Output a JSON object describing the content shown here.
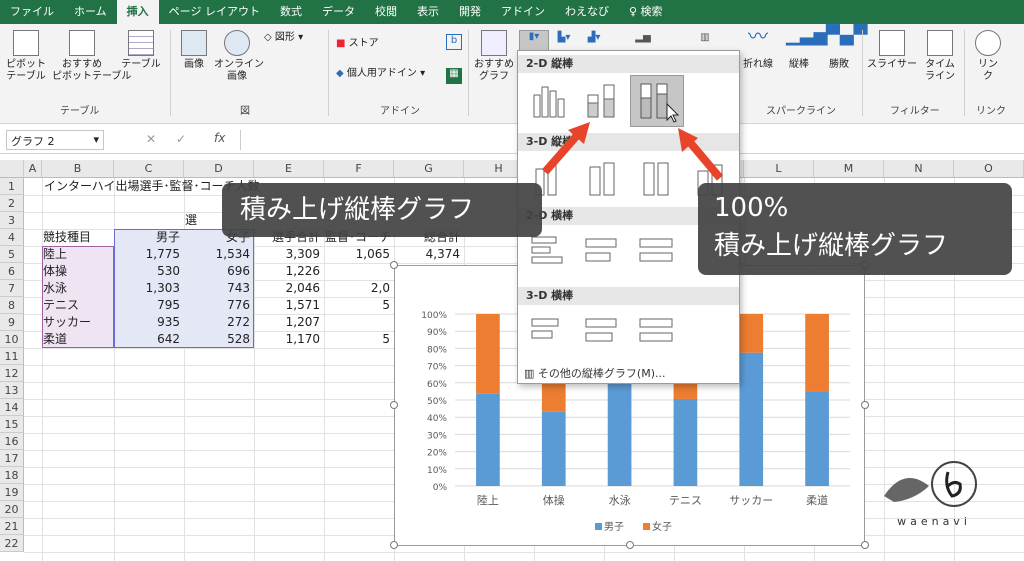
{
  "ribbon_tabs": [
    "ファイル",
    "ホーム",
    "挿入",
    "ページ レイアウト",
    "数式",
    "データ",
    "校閲",
    "表示",
    "開発",
    "アドイン",
    "わえなび",
    "検索"
  ],
  "ribbon": {
    "pivot_label": "ピボット\nテーブル",
    "recommended_pivot_label": "おすすめ\nピボットテーブル",
    "table_label": "テーブル",
    "group_table": "テーブル",
    "image_label": "画像",
    "online_image_label": "オンライン\n画像",
    "shapes_label": "図形",
    "group_figure": "図",
    "store_label": "ストア",
    "personal_addin_label": "個人用アドイン",
    "group_addin": "アドイン",
    "recommended_chart_label": "おすすめ\nグラフ",
    "line_label": "折れ線",
    "column_label": "縦棒",
    "winloss_label": "勝敗",
    "group_sparkline": "スパークライン",
    "slicer_label": "スライサー",
    "timeline_label": "タイム\nライン",
    "group_filter": "フィルター",
    "link_label": "リン\nク",
    "group_link": "リンク"
  },
  "namebox": "グラフ 2",
  "fx": "fx",
  "columns": [
    "A",
    "B",
    "C",
    "D",
    "E",
    "F",
    "G",
    "H",
    "I",
    "J",
    "K",
    "L",
    "M",
    "N",
    "O"
  ],
  "rows": [
    "1",
    "2",
    "3",
    "4",
    "5",
    "6",
    "7",
    "8",
    "9",
    "10",
    "11",
    "12",
    "13",
    "14",
    "15",
    "16",
    "17",
    "18",
    "19",
    "20",
    "21",
    "22"
  ],
  "sheet": {
    "title": "インターハイ出場選手･監督･コーチ人数",
    "sub": "選",
    "headers": [
      "競技種目",
      "男子",
      "女子",
      "選手合計",
      "監督･コーチ",
      "総合計"
    ],
    "data": [
      [
        "陸上",
        "1,775",
        "1,534",
        "3,309",
        "1,065",
        "4,374"
      ],
      [
        "体操",
        "530",
        "696",
        "1,226",
        "",
        ""
      ],
      [
        "水泳",
        "1,303",
        "743",
        "2,046",
        "2,0",
        ""
      ],
      [
        "テニス",
        "795",
        "776",
        "1,571",
        "5",
        ""
      ],
      [
        "サッカー",
        "935",
        "272",
        "1,207",
        "",
        ""
      ],
      [
        "柔道",
        "642",
        "528",
        "1,170",
        "5",
        ""
      ]
    ]
  },
  "dropdown": {
    "sec1": "2-D 縦棒",
    "sec2": "3-D 縦棒",
    "sec3": "2-D 横棒",
    "sec4": "3-D 横棒",
    "more": "その他の縦棒グラフ(M)..."
  },
  "callouts": {
    "left": "積み上げ縦棒グラフ",
    "right_line1": "100%",
    "right_line2": "積み上げ縦棒グラフ"
  },
  "watermark": "waenavi",
  "chart_data": {
    "type": "bar",
    "stacked": "100%",
    "categories": [
      "陸上",
      "体操",
      "水泳",
      "テニス",
      "サッカー",
      "柔道"
    ],
    "series": [
      {
        "name": "男子",
        "values": [
          53.6,
          43.2,
          63.7,
          50.6,
          77.5,
          54.9
        ],
        "color": "#5b9bd5"
      },
      {
        "name": "女子",
        "values": [
          46.4,
          56.8,
          36.3,
          49.4,
          22.5,
          45.1
        ],
        "color": "#ed7d31"
      }
    ],
    "yticks": [
      "0%",
      "10%",
      "20%",
      "30%",
      "40%",
      "50%",
      "60%",
      "70%",
      "80%",
      "90%",
      "100%"
    ],
    "ylim": [
      0,
      100
    ],
    "legend": "bottom",
    "grid": true
  }
}
